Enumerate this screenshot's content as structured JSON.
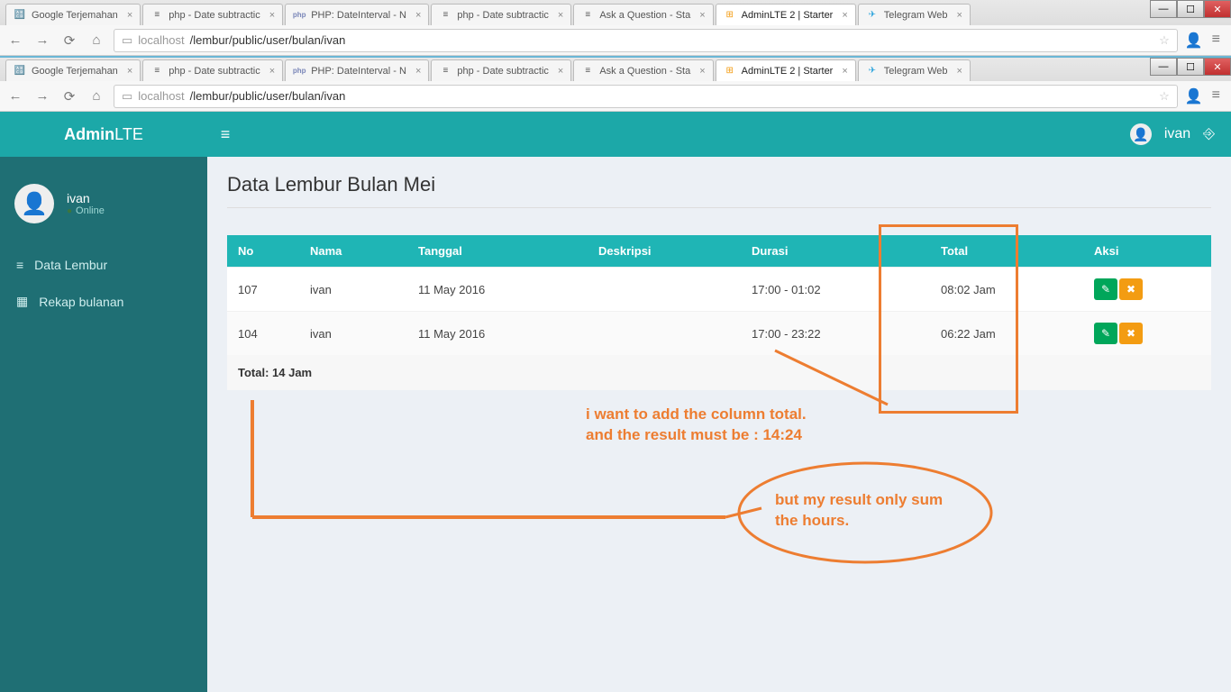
{
  "browser": {
    "tabs": [
      {
        "label": "Google Terjemahan",
        "icon": "🔠",
        "active": false
      },
      {
        "label": "php - Date subtractic",
        "icon": "≡",
        "active": false
      },
      {
        "label": "PHP: DateInterval - N",
        "icon": "php",
        "active": false
      },
      {
        "label": "php - Date subtractic",
        "icon": "≡",
        "active": false
      },
      {
        "label": "Ask a Question - Sta",
        "icon": "≡",
        "active": false
      },
      {
        "label": "AdminLTE 2 | Starter",
        "icon": "⊞",
        "active": true
      },
      {
        "label": "Telegram Web",
        "icon": "✈",
        "active": false
      }
    ],
    "url_host": "localhost",
    "url_path": "/lembur/public/user/bulan/ivan"
  },
  "app": {
    "brand_left": "Admin",
    "brand_right": "LTE",
    "user": {
      "name": "ivan",
      "status": "Online"
    },
    "menu": [
      {
        "icon": "≡",
        "label": "Data Lembur"
      },
      {
        "icon": "▦",
        "label": "Rekap bulanan"
      }
    ],
    "page_title": "Data Lembur Bulan Mei",
    "table": {
      "headers": [
        "No",
        "Nama",
        "Tanggal",
        "Deskripsi",
        "Durasi",
        "Total",
        "Aksi"
      ],
      "rows": [
        {
          "no": "107",
          "nama": "ivan",
          "tanggal": "11 May 2016",
          "deskripsi": "",
          "durasi": "17:00 - 01:02",
          "total": "08:02 Jam"
        },
        {
          "no": "104",
          "nama": "ivan",
          "tanggal": "11 May 2016",
          "deskripsi": "",
          "durasi": "17:00 - 23:22",
          "total": "06:22 Jam"
        }
      ],
      "footer": "Total: 14 Jam"
    }
  },
  "annotations": {
    "line1": "i want to add the column total.",
    "line2": "and the result must be : 14:24",
    "line3": "but my result only sum",
    "line4": "the hours."
  }
}
